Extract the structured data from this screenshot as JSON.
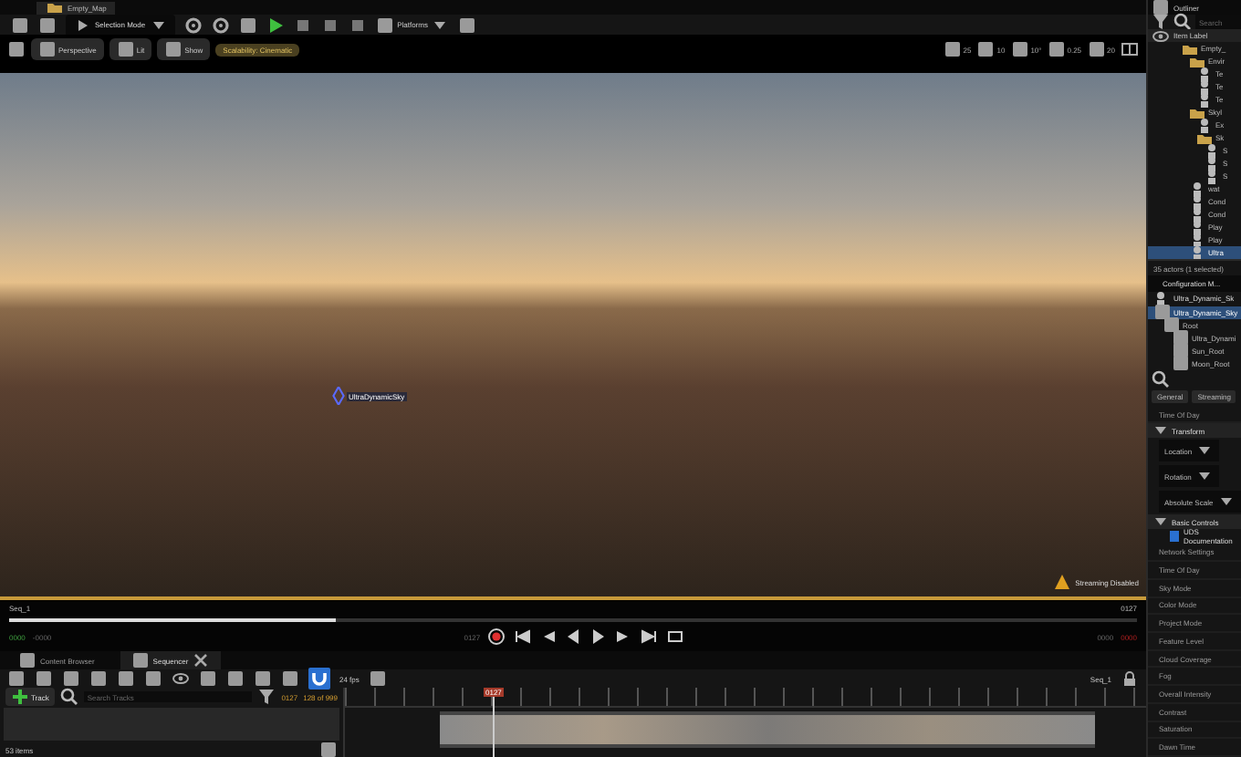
{
  "window": {
    "title": "Empty_Map"
  },
  "main_toolbar": {
    "mode": "Selection Mode",
    "platforms": "Platforms"
  },
  "viewport": {
    "buttons": [
      {
        "label": "Perspective"
      },
      {
        "label": "Lit"
      },
      {
        "label": "Show"
      }
    ],
    "scalability": "Scalability: Cinematic",
    "stats": [
      "25",
      "10",
      "10°",
      "0.25",
      "20"
    ],
    "actor_label": "UltraDynamicSky",
    "streaming": "Streaming Disabled"
  },
  "playback": {
    "sequence": "Seq_1",
    "end_frame": "0127",
    "level": 0.29,
    "left_times": [
      "0000",
      "-0000"
    ],
    "current": "0127",
    "right_times": [
      "0000",
      "0000"
    ]
  },
  "tabs": [
    {
      "label": "Content Browser",
      "selected": false,
      "closable": false
    },
    {
      "label": "Sequencer",
      "selected": true,
      "closable": true
    }
  ],
  "sequencer": {
    "fps": "24 fps",
    "sequence": "Seq_1",
    "add_track": "Track",
    "search": {
      "placeholder": "Search Tracks"
    },
    "current": "0127",
    "count": "128 of 999",
    "playhead": "0127",
    "items": "53 items"
  },
  "outliner": {
    "title": "Outliner",
    "search": {
      "placeholder": "Search"
    },
    "column": "Item Label",
    "rows": [
      {
        "label": "Empty_",
        "selected": false,
        "children": [
          {
            "label": "Envir",
            "selected": false,
            "children": [
              {
                "label": "Te",
                "selected": false
              },
              {
                "label": "Te",
                "selected": false
              },
              {
                "label": "Te",
                "selected": false
              }
            ]
          },
          {
            "label": "Skyl",
            "selected": false,
            "children": [
              {
                "label": "Ex",
                "selected": false
              },
              {
                "label": "Sk",
                "selected": false,
                "children": [
                  {
                    "label": "S",
                    "selected": false
                  },
                  {
                    "label": "S",
                    "selected": false
                  },
                  {
                    "label": "S",
                    "selected": false
                  }
                ]
              }
            ]
          },
          {
            "label": "wat",
            "selected": false
          },
          {
            "label": "Cond",
            "selected": false
          },
          {
            "label": "Cond",
            "selected": false
          },
          {
            "label": "Play",
            "selected": false
          },
          {
            "label": "Play",
            "selected": false
          },
          {
            "label": "Ultra",
            "selected": true
          }
        ]
      }
    ],
    "footer": "35 actors (1 selected)"
  },
  "details": {
    "tab": "Configuration M...",
    "actor": "Ultra_Dynamic_Sk",
    "components": [
      {
        "label": "Ultra_Dynamic_Sky",
        "selected": true,
        "children": [
          {
            "label": "Root",
            "selected": false,
            "children": [
              {
                "label": "Ultra_Dynami",
                "selected": false
              },
              {
                "label": "Sun_Root",
                "selected": false
              },
              {
                "label": "Moon_Root",
                "selected": false
              }
            ]
          }
        ]
      }
    ],
    "filters": [
      "General",
      "Streaming"
    ],
    "top_property": "Time Of Day",
    "transform": {
      "title": "Transform",
      "expanded": true,
      "fields": [
        "Location",
        "Rotation",
        "Absolute Scale"
      ]
    },
    "basic": {
      "title": "Basic Controls",
      "expanded": true,
      "checkbox": {
        "label": "UDS Documentation",
        "checked": true
      },
      "properties": [
        "Network Settings",
        "Time Of Day",
        "Sky Mode",
        "Color Mode",
        "Project Mode",
        "Feature Level",
        "Cloud Coverage",
        "Fog",
        "Overall Intensity",
        "Contrast",
        "Saturation",
        "Dawn Time"
      ]
    }
  }
}
